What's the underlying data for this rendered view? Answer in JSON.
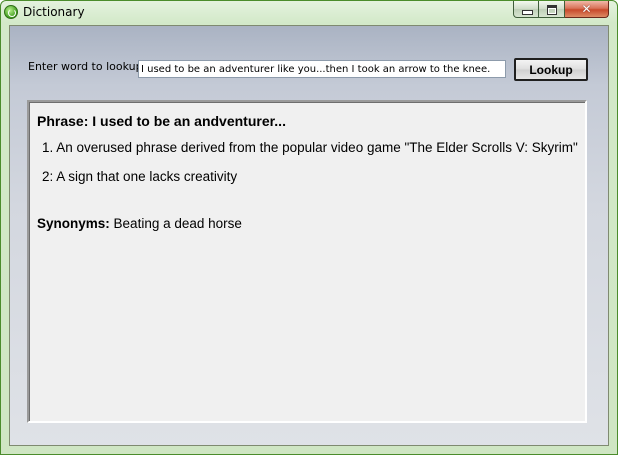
{
  "window": {
    "title": "Dictionary"
  },
  "icons": {
    "app": "dictionary-app-icon",
    "minimize": "minimize-icon",
    "maximize": "maximize-icon",
    "close": "close-icon"
  },
  "caption": {
    "close_glyph": "✕"
  },
  "colors": {
    "frame_green": "#cfe6c3",
    "client_top": "#aab3c3",
    "results_bg": "#f0f0f0",
    "close_red": "#c84a2c"
  },
  "lookup": {
    "label": "Enter word to lookup:",
    "value": "I used to be an adventurer like you...then I took an arrow to the knee.",
    "button_label": "Lookup"
  },
  "results": {
    "phrase_title": "Phrase: I used to be an andventurer...",
    "definitions": [
      "1. An overused phrase derived from the popular video game \"The Elder Scrolls V: Skyrim\"",
      "2: A sign that one lacks creativity"
    ],
    "synonyms_label": "Synonyms:",
    "synonyms_value": "Beating a dead horse"
  }
}
